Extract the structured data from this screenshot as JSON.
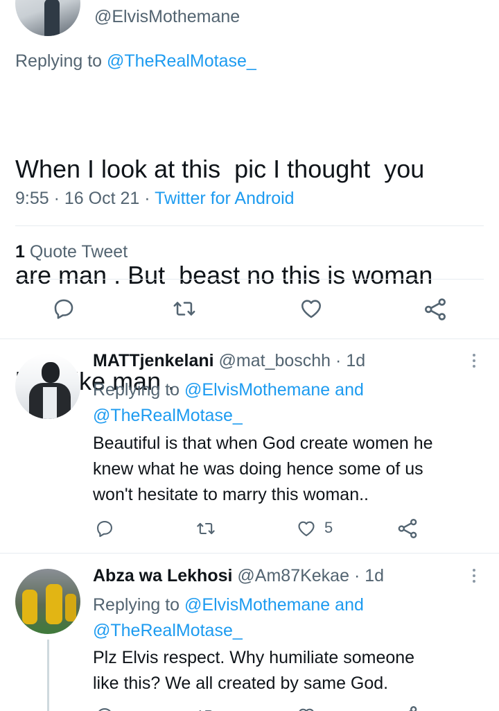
{
  "main_tweet": {
    "handle": "@ElvisMothemane",
    "replying_prefix": "Replying to",
    "replying_to": "@TheRealMotase_",
    "text_line1": "When I look at this  pic I thought  you",
    "text_line2": "are man . But  beast no this is woman",
    "text_line3": "look like man .",
    "time": "9:55",
    "date": "16 Oct 21",
    "source": "Twitter for Android",
    "quote_count": "1",
    "quote_label": "Quote Tweet",
    "actions": [
      "reply-icon",
      "retweet-icon",
      "like-icon",
      "share-icon"
    ]
  },
  "replies": [
    {
      "name": "MATTjenkelani",
      "handle": "@mat_boschh",
      "time": "1d",
      "replying_prefix": "Replying to",
      "replying_to_1": "@ElvisMothemane",
      "replying_and": "and",
      "replying_to_2": "@TheRealMotase_",
      "text_line1": "Beautiful is that when God create women he",
      "text_line2": "knew what he was doing hence some of us",
      "text_line3": "won't hesitate to marry this woman..",
      "like_count": "5"
    },
    {
      "name": "Abza wa Lekhosi",
      "handle": "@Am87Kekae",
      "time": "1d",
      "replying_prefix": "Replying to",
      "replying_to_1": "@ElvisMothemane",
      "replying_and": "and",
      "replying_to_2": "@TheRealMotase_",
      "text_line1": "Plz Elvis respect. Why humiliate someone",
      "text_line2": "like this? We all created by same God."
    }
  ],
  "colors": {
    "accent": "#1d9bf0",
    "secondary_text": "#536471",
    "divider": "#e6ecf0"
  }
}
